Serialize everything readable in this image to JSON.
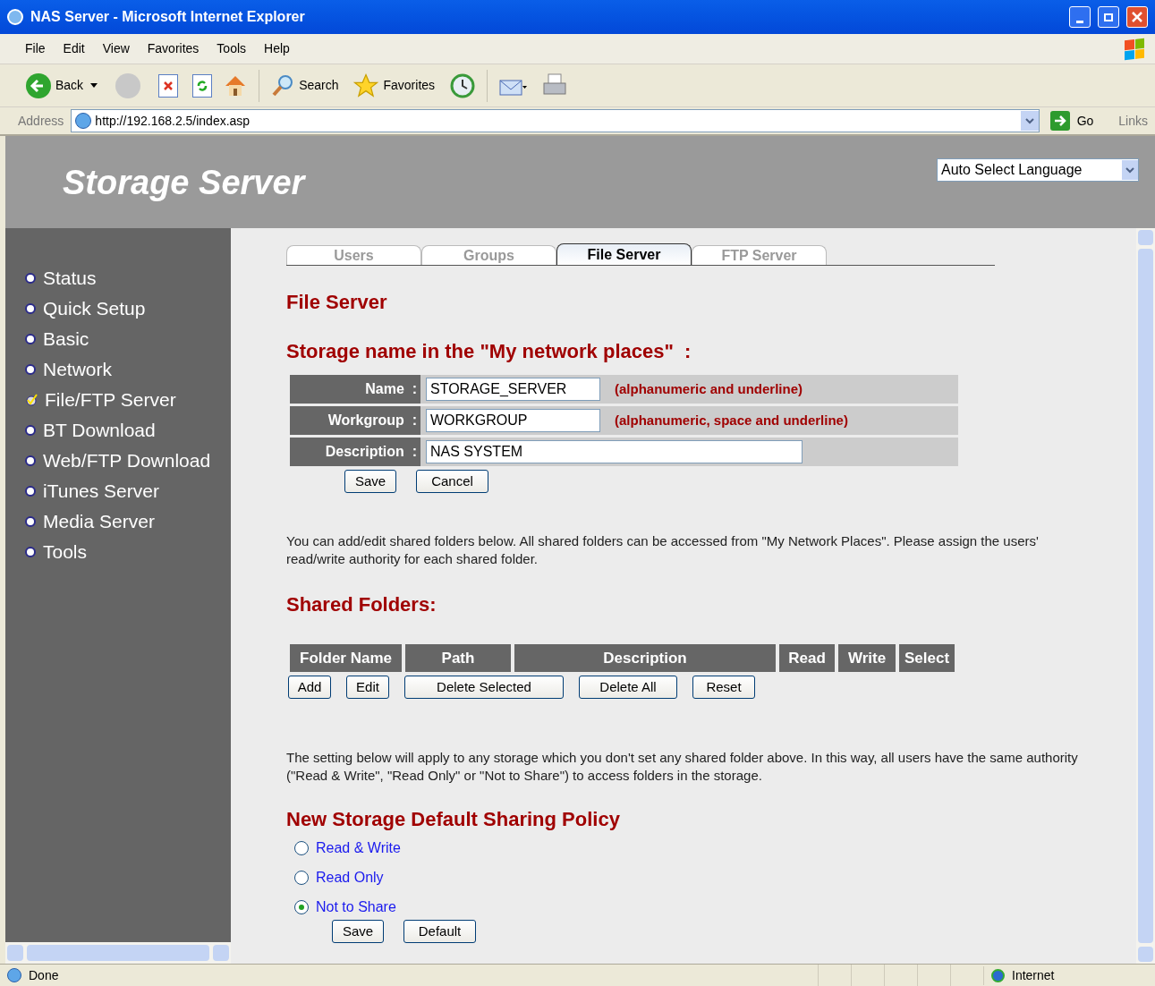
{
  "window": {
    "title": "NAS Server - Microsoft Internet Explorer"
  },
  "menu": [
    "File",
    "Edit",
    "View",
    "Favorites",
    "Tools",
    "Help"
  ],
  "toolbar": {
    "back": "Back",
    "search": "Search",
    "favorites": "Favorites"
  },
  "address": {
    "label": "Address",
    "url": "http://192.168.2.5/index.asp",
    "go": "Go",
    "links": "Links"
  },
  "header": {
    "title": "Storage Server",
    "language": "Auto Select Language"
  },
  "sidebar": {
    "items": [
      {
        "label": "Status",
        "selected": false
      },
      {
        "label": "Quick Setup",
        "selected": false
      },
      {
        "label": "Basic",
        "selected": false
      },
      {
        "label": "Network",
        "selected": false
      },
      {
        "label": "File/FTP Server",
        "selected": true
      },
      {
        "label": "BT Download",
        "selected": false
      },
      {
        "label": "Web/FTP Download",
        "selected": false
      },
      {
        "label": "iTunes Server",
        "selected": false
      },
      {
        "label": "Media Server",
        "selected": false
      },
      {
        "label": "Tools",
        "selected": false
      }
    ]
  },
  "tabs": [
    {
      "label": "Users",
      "selected": false
    },
    {
      "label": "Groups",
      "selected": false
    },
    {
      "label": "File Server",
      "selected": true
    },
    {
      "label": "FTP Server",
      "selected": false
    }
  ],
  "page_title": "File Server",
  "storage_name": {
    "title": "Storage name in the \"My network places\"  :",
    "fields": [
      {
        "label": "Name  :",
        "value": "STORAGE_SERVER",
        "hint": "(alphanumeric and underline)",
        "kind": "short"
      },
      {
        "label": "Workgroup  :",
        "value": "WORKGROUP",
        "hint": "(alphanumeric, space and underline)",
        "kind": "short"
      },
      {
        "label": "Description  :",
        "value": "NAS SYSTEM",
        "kind": "long"
      }
    ],
    "buttons": [
      "Save",
      "Cancel"
    ]
  },
  "shared_intro": "You can add/edit shared folders below. All shared folders can be accessed from \"My Network Places\". Please assign the users' read/write authority for each shared folder.",
  "shared_folders": {
    "title": "Shared Folders:",
    "columns": [
      "Folder Name",
      "Path",
      "Description",
      "Read",
      "Write",
      "Select"
    ],
    "buttons": [
      "Add",
      "Edit",
      "Delete Selected",
      "Delete All",
      "Reset"
    ]
  },
  "policy_intro": "The setting below will apply to any storage which you don't set any shared folder above. In this way, all users have the same authority (\"Read & Write\", \"Read Only\" or \"Not to Share\") to access folders in the storage.",
  "policy": {
    "title": "New Storage Default Sharing Policy",
    "options": [
      {
        "label": "Read & Write",
        "selected": false
      },
      {
        "label": "Read Only",
        "selected": false
      },
      {
        "label": "Not to Share",
        "selected": true
      }
    ],
    "buttons": [
      "Save",
      "Default"
    ]
  },
  "status_bar": {
    "text": "Done",
    "zone": "Internet"
  }
}
